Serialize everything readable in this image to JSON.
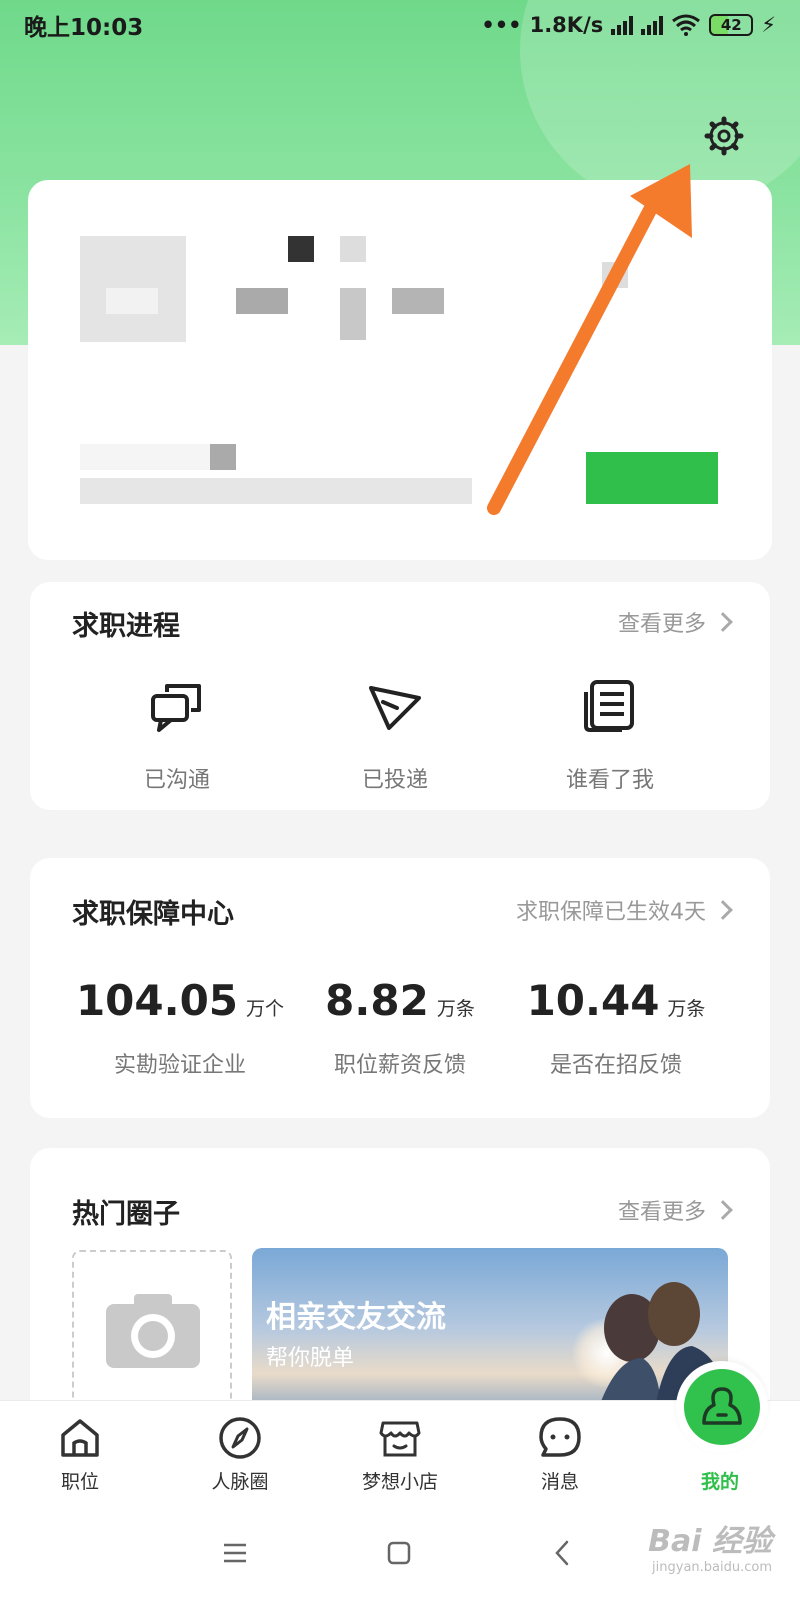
{
  "status_bar": {
    "time": "晚上10:03",
    "net_speed": "1.8K/s",
    "battery": "42"
  },
  "icons": {
    "settings": "gear-icon",
    "arrow": "orange-arrow-annotation"
  },
  "colors": {
    "brand_green": "#2fbf4a",
    "header_green": "#7ddc93",
    "arrow_orange": "#f47a2c"
  },
  "job_progress": {
    "title": "求职进程",
    "more": "查看更多",
    "items": [
      {
        "label": "已沟通",
        "icon": "chat-bubbles-icon"
      },
      {
        "label": "已投递",
        "icon": "paper-plane-icon"
      },
      {
        "label": "谁看了我",
        "icon": "document-list-icon"
      }
    ]
  },
  "protection": {
    "title": "求职保障中心",
    "more": "求职保障已生效4天",
    "stats": [
      {
        "value": "104.05",
        "unit": "万个",
        "label": "实勘验证企业"
      },
      {
        "value": "8.82",
        "unit": "万条",
        "label": "职位薪资反馈"
      },
      {
        "value": "10.44",
        "unit": "万条",
        "label": "是否在招反馈"
      }
    ]
  },
  "circles": {
    "title": "热门圈子",
    "more": "查看更多",
    "banner_title": "相亲交友交流",
    "banner_sub": "帮你脱单"
  },
  "tabbar": {
    "items": [
      {
        "label": "职位",
        "icon": "home-icon"
      },
      {
        "label": "人脉圈",
        "icon": "compass-icon"
      },
      {
        "label": "梦想小店",
        "icon": "store-icon"
      },
      {
        "label": "消息",
        "icon": "chat-icon"
      },
      {
        "label": "我的",
        "icon": "profile-icon",
        "active": true
      }
    ]
  },
  "watermark": {
    "brand": "Bai 经验",
    "url": "jingyan.baidu.com"
  }
}
